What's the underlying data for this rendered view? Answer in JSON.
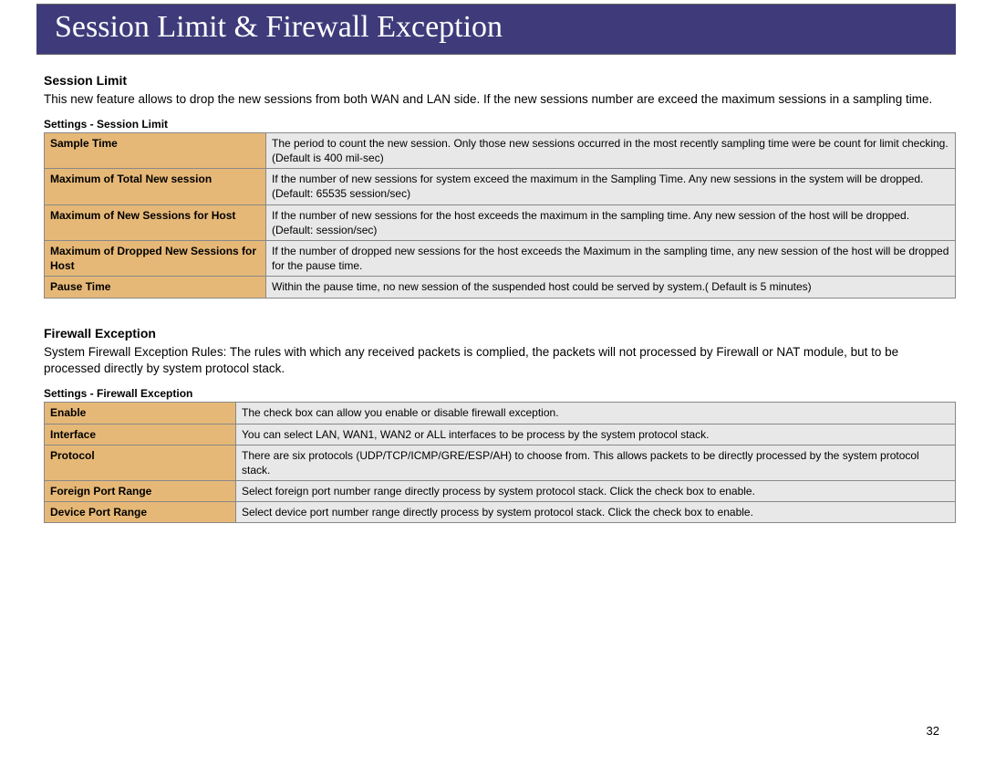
{
  "header": {
    "title": "Session Limit & Firewall Exception"
  },
  "session_limit": {
    "heading": "Session Limit",
    "body": "This new feature allows to drop the new sessions from both WAN and LAN side. If the new sessions number are exceed the maximum sessions in a sampling time.",
    "table_caption": "Settings - Session Limit",
    "rows": [
      {
        "key": "Sample Time",
        "val": "The period to count the new session. Only those new sessions occurred in the most recently sampling time were be count for limit checking. (Default is 400 mil-sec)"
      },
      {
        "key": "Maximum of Total New session",
        "val": "If the number of new sessions for system exceed the maximum in the Sampling Time. Any new sessions in the system will be dropped. (Default: 65535 session/sec)"
      },
      {
        "key": "Maximum of New Sessions for Host",
        "val": "If the number of new sessions for the host exceeds the maximum in the sampling time. Any new session of the host will be dropped. (Default: session/sec)"
      },
      {
        "key": "Maximum of Dropped New Sessions for Host",
        "val": "If the number of dropped new sessions for the host exceeds the Maximum in the sampling time, any new session of the host will be dropped for the pause time."
      },
      {
        "key": "Pause Time",
        "val": "Within the pause time, no new session of the suspended host could be served by system.( Default is 5 minutes)"
      }
    ]
  },
  "firewall_exception": {
    "heading": "Firewall Exception",
    "body": "System Firewall Exception Rules: The rules with which any received packets is complied, the packets will not processed by Firewall or NAT module, but to be processed directly by system protocol stack.",
    "table_caption": "Settings - Firewall Exception",
    "rows": [
      {
        "key": "Enable",
        "val": "The check box can allow you enable or disable firewall exception."
      },
      {
        "key": "Interface",
        "val": "You can select LAN, WAN1, WAN2 or ALL interfaces to be process by the system protocol stack."
      },
      {
        "key": "Protocol",
        "val": "There are six protocols (UDP/TCP/ICMP/GRE/ESP/AH) to choose from. This allows packets to be directly processed by the system protocol stack."
      },
      {
        "key": "Foreign Port Range",
        "val": "Select foreign port number range directly process by system protocol stack. Click the check box to enable."
      },
      {
        "key": "Device Port Range",
        "val": "Select device port number range directly process by system protocol stack. Click the check box to enable."
      }
    ]
  },
  "page_number": "32"
}
